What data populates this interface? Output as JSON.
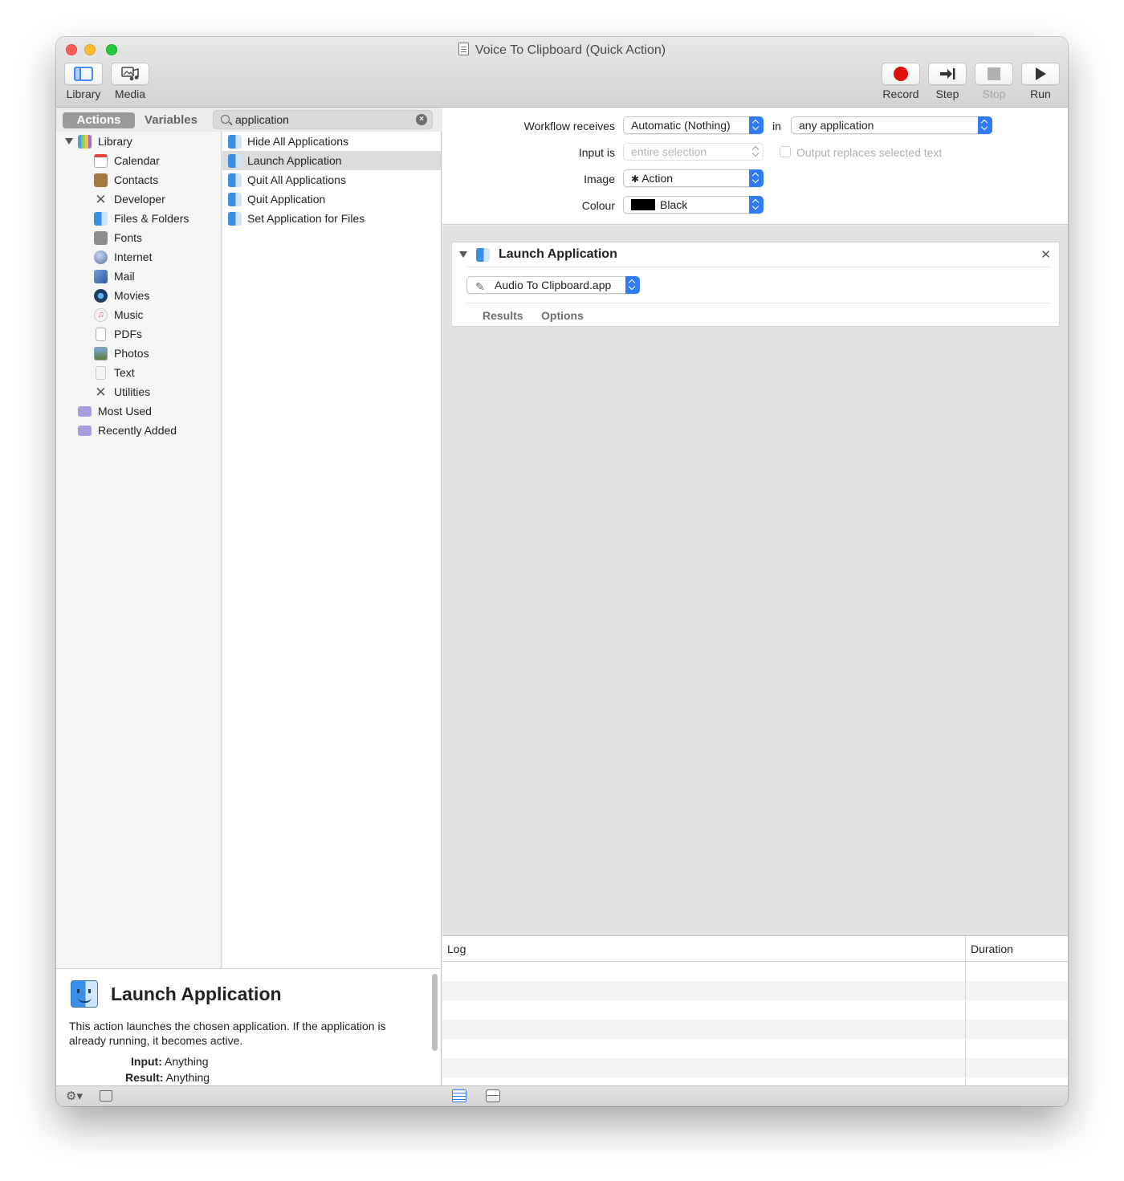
{
  "window": {
    "title": "Voice To Clipboard (Quick Action)",
    "colors": {
      "close": "#fe5f57",
      "minimize": "#febc2e",
      "zoom": "#28c840",
      "accent": "#2f7cf6",
      "record": "#e0100c"
    }
  },
  "toolbar": {
    "library_label": "Library",
    "media_label": "Media",
    "record_label": "Record",
    "step_label": "Step",
    "stop_label": "Stop",
    "run_label": "Run"
  },
  "library_tabs": {
    "actions": "Actions",
    "variables": "Variables"
  },
  "search": {
    "value": "application"
  },
  "library": {
    "root": "Library",
    "categories": [
      {
        "label": "Calendar",
        "icon": "calendar-icon"
      },
      {
        "label": "Contacts",
        "icon": "contacts-icon"
      },
      {
        "label": "Developer",
        "icon": "developer-icon"
      },
      {
        "label": "Files & Folders",
        "icon": "finder-icon"
      },
      {
        "label": "Fonts",
        "icon": "fonts-icon"
      },
      {
        "label": "Internet",
        "icon": "globe-icon"
      },
      {
        "label": "Mail",
        "icon": "mail-icon"
      },
      {
        "label": "Movies",
        "icon": "movies-icon"
      },
      {
        "label": "Music",
        "icon": "music-icon"
      },
      {
        "label": "PDFs",
        "icon": "pdf-icon"
      },
      {
        "label": "Photos",
        "icon": "photos-icon"
      },
      {
        "label": "Text",
        "icon": "text-icon"
      },
      {
        "label": "Utilities",
        "icon": "utilities-icon"
      }
    ],
    "smart_groups": [
      {
        "label": "Most Used",
        "icon": "smart-folder-icon"
      },
      {
        "label": "Recently Added",
        "icon": "smart-folder-icon"
      }
    ]
  },
  "actions": [
    {
      "label": "Hide All Applications"
    },
    {
      "label": "Launch Application"
    },
    {
      "label": "Quit All Applications"
    },
    {
      "label": "Quit Application"
    },
    {
      "label": "Set Application for Files"
    }
  ],
  "selected_action": "Launch Application",
  "description": {
    "title": "Launch Application",
    "body": "This action launches the chosen application. If the application is already running, it becomes active.",
    "input_label": "Input:",
    "input_value": "Anything",
    "result_label": "Result:",
    "result_value": "Anything"
  },
  "workflow": {
    "receives_label": "Workflow receives",
    "receives_value": "Automatic (Nothing)",
    "in_label": "in",
    "in_value": "any application",
    "input_is_label": "Input is",
    "input_is_value": "entire selection",
    "output_replaces_label": "Output replaces selected text",
    "image_label": "Image",
    "image_value": "Action",
    "colour_label": "Colour",
    "colour_value": "Black",
    "colour_swatch": "#000000"
  },
  "action_card": {
    "title": "Launch Application",
    "app_value": "Audio To Clipboard.app",
    "results_tab": "Results",
    "options_tab": "Options"
  },
  "log": {
    "log_header": "Log",
    "duration_header": "Duration"
  }
}
